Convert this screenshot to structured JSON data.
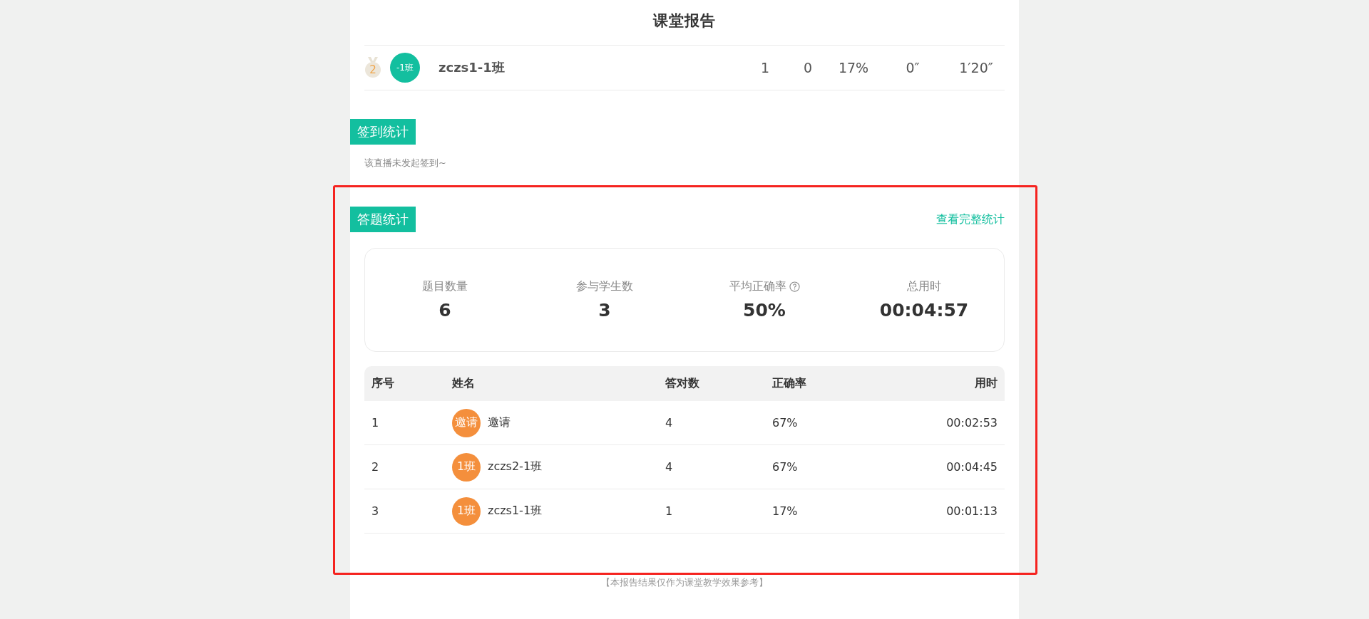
{
  "title": "课堂报告",
  "rank_row": {
    "rank": "2",
    "avatar": "-1班",
    "name": "zczs1-1班",
    "stats": [
      "1",
      "0",
      "17%",
      "0″",
      "1′20″"
    ]
  },
  "checkin": {
    "heading": "签到统计",
    "message": "该直播未发起签到~"
  },
  "answers": {
    "heading": "答题统计",
    "link": "查看完整统计",
    "highlighted": true,
    "summary": [
      {
        "label": "题目数量",
        "value": "6",
        "help": false
      },
      {
        "label": "参与学生数",
        "value": "3",
        "help": false
      },
      {
        "label": "平均正确率",
        "value": "50%",
        "help": true
      },
      {
        "label": "总用时",
        "value": "00:04:57",
        "help": false
      }
    ],
    "table": {
      "columns": [
        "序号",
        "姓名",
        "答对数",
        "正确率",
        "用时"
      ],
      "rows": [
        {
          "index": "1",
          "avatar": "邀请",
          "name": "邀请",
          "correct": "4",
          "rate": "67%",
          "time": "00:02:53"
        },
        {
          "index": "2",
          "avatar": "1班",
          "name": "zczs2-1班",
          "correct": "4",
          "rate": "67%",
          "time": "00:04:45"
        },
        {
          "index": "3",
          "avatar": "1班",
          "name": "zczs1-1班",
          "correct": "1",
          "rate": "17%",
          "time": "00:01:13"
        }
      ]
    }
  },
  "footer": "【本报告结果仅作为课堂教学效果参考】"
}
